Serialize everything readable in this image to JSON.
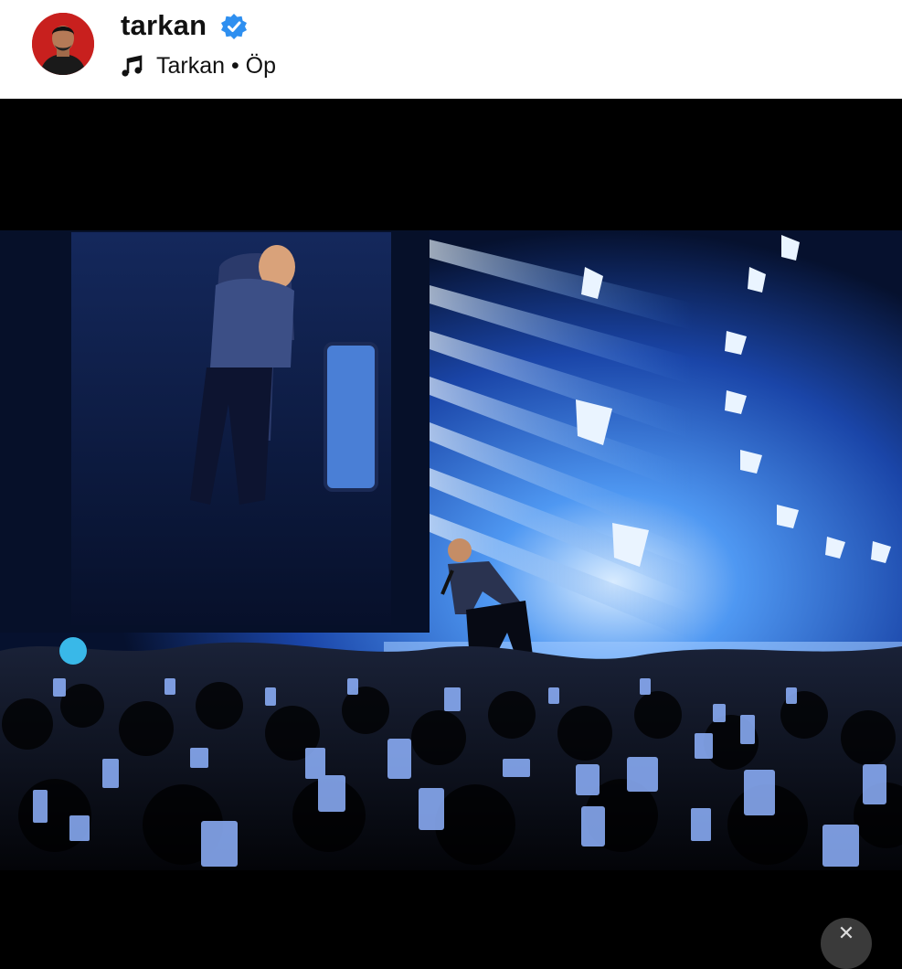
{
  "post": {
    "username": "tarkan",
    "verified": true,
    "audio_label": "Tarkan • Öp"
  },
  "icons": {
    "verified": "verified-badge-icon",
    "music": "music-note-icon",
    "close": "close-icon"
  },
  "colors": {
    "verified_blue": "#2e8ff0",
    "avatar_bg": "#c8201e",
    "stage_blue": "#2f79e8"
  }
}
